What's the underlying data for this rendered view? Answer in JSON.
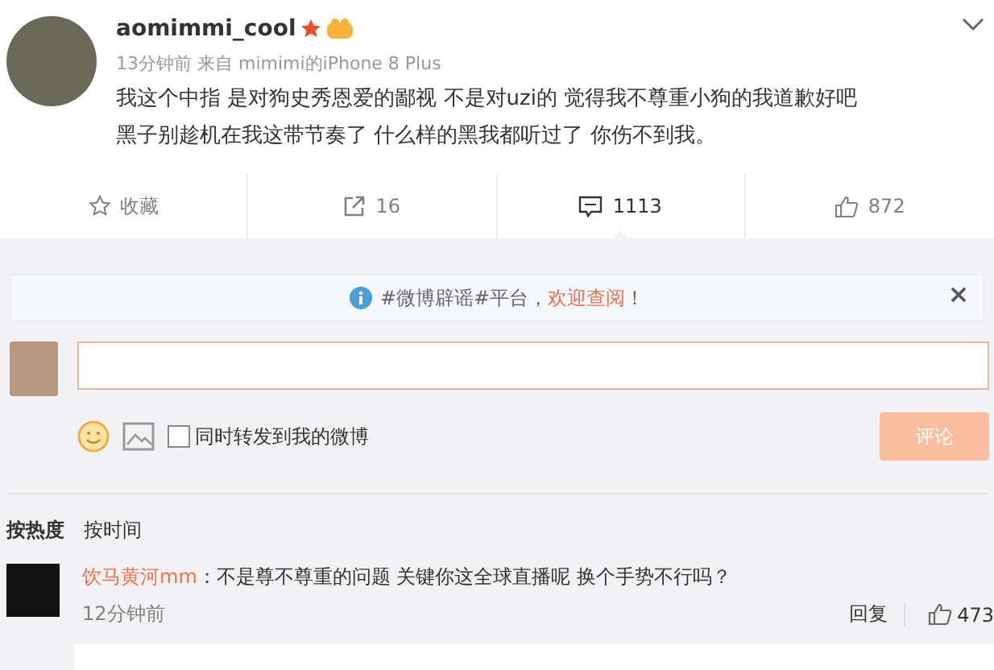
{
  "post": {
    "username": "aomimmi_cool",
    "meta": "13分钟前 来自 mimimi的iPhone 8 Plus",
    "text_lines": [
      "我这个中指 是对狗史秀恩爱的鄙视 不是对uzi的 觉得我不尊重小狗的我道歉好吧",
      "黑子别趁机在我这带节奏了 什么样的黑我都听过了 你伤不到我。"
    ]
  },
  "actions": [
    {
      "kind": "favorite",
      "label": "收藏",
      "selected": false
    },
    {
      "kind": "repost",
      "label": "16",
      "selected": false
    },
    {
      "kind": "comment",
      "label": "1113",
      "selected": true
    },
    {
      "kind": "like",
      "label": "872",
      "selected": false
    }
  ],
  "notice": {
    "prefix": "#微博辟谣#平台，",
    "link": "欢迎查阅",
    "suffix": "！"
  },
  "composer": {
    "repost_label": "同时转发到我的微博",
    "repost_checked": false,
    "submit": "评论",
    "submit_disabled": true
  },
  "sort_tabs": [
    {
      "label": "按热度",
      "selected": true
    },
    {
      "label": "按时间",
      "selected": false
    }
  ],
  "comments": [
    {
      "author": "饮马黄河mm",
      "text": "：不是尊不尊重的问题 关键你这全球直播呢 换个手势不行吗？",
      "time": "12分钟前",
      "reply": "回复",
      "likes": "473"
    }
  ]
}
